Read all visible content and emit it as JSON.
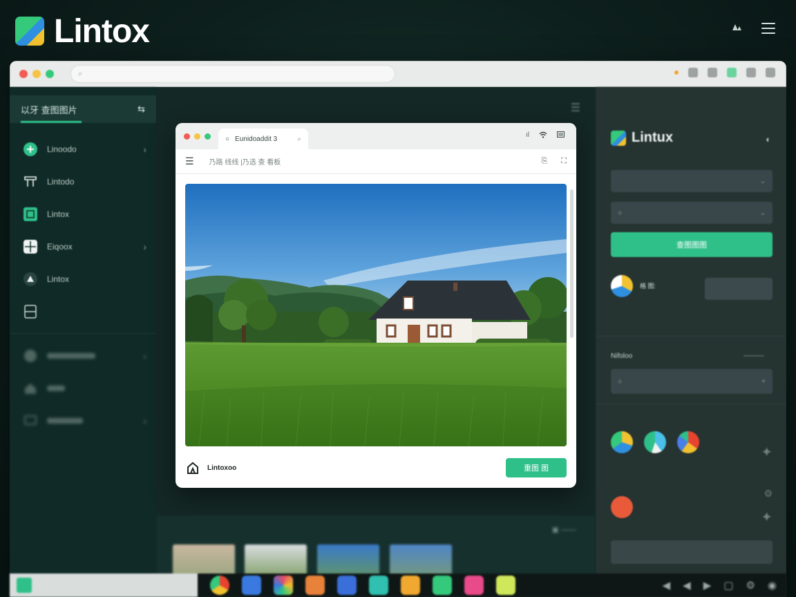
{
  "brand": {
    "name": "Lintox"
  },
  "top_bar": {
    "settings_icon": "gear-icon",
    "menu_icon": "menu-icon"
  },
  "outer_browser": {
    "traffic_lights": [
      "#f25c54",
      "#f6c343",
      "#35c97c"
    ]
  },
  "sidebar": {
    "header_label": "以牙 查图图片",
    "items": [
      {
        "label": "Linoodo",
        "icon": "plus-circle-icon",
        "chevron": true
      },
      {
        "label": "Lintodo",
        "icon": "screen-icon",
        "chevron": false
      },
      {
        "label": "Lintox",
        "icon": "app-window-icon",
        "chevron": false
      },
      {
        "label": "Eiqoox",
        "icon": "grid-icon",
        "chevron": true
      },
      {
        "label": "Lintox",
        "icon": "triangle-icon",
        "chevron": false
      },
      {
        "label": "",
        "icon": "panel-icon",
        "chevron": false
      }
    ]
  },
  "inner_browser": {
    "tab_title": "Eunidoaddit 3",
    "toolbar_text": "乃路 线线 |乃选 查 看板",
    "footer": {
      "title": "Lintoxoo",
      "subtitle": ""
    },
    "primary_button": "重图 图"
  },
  "gallery": {
    "title": ""
  },
  "right_panel": {
    "brand": "Lintux",
    "cta_label": "查图图图",
    "user": {
      "name": "格 图:",
      "subtitle": ""
    },
    "secondary_button_label": "",
    "section_label": "Nifoloo",
    "colors": {
      "accent": "#2fc08a",
      "panel": "#253331"
    }
  },
  "taskbar": {
    "label": ""
  }
}
